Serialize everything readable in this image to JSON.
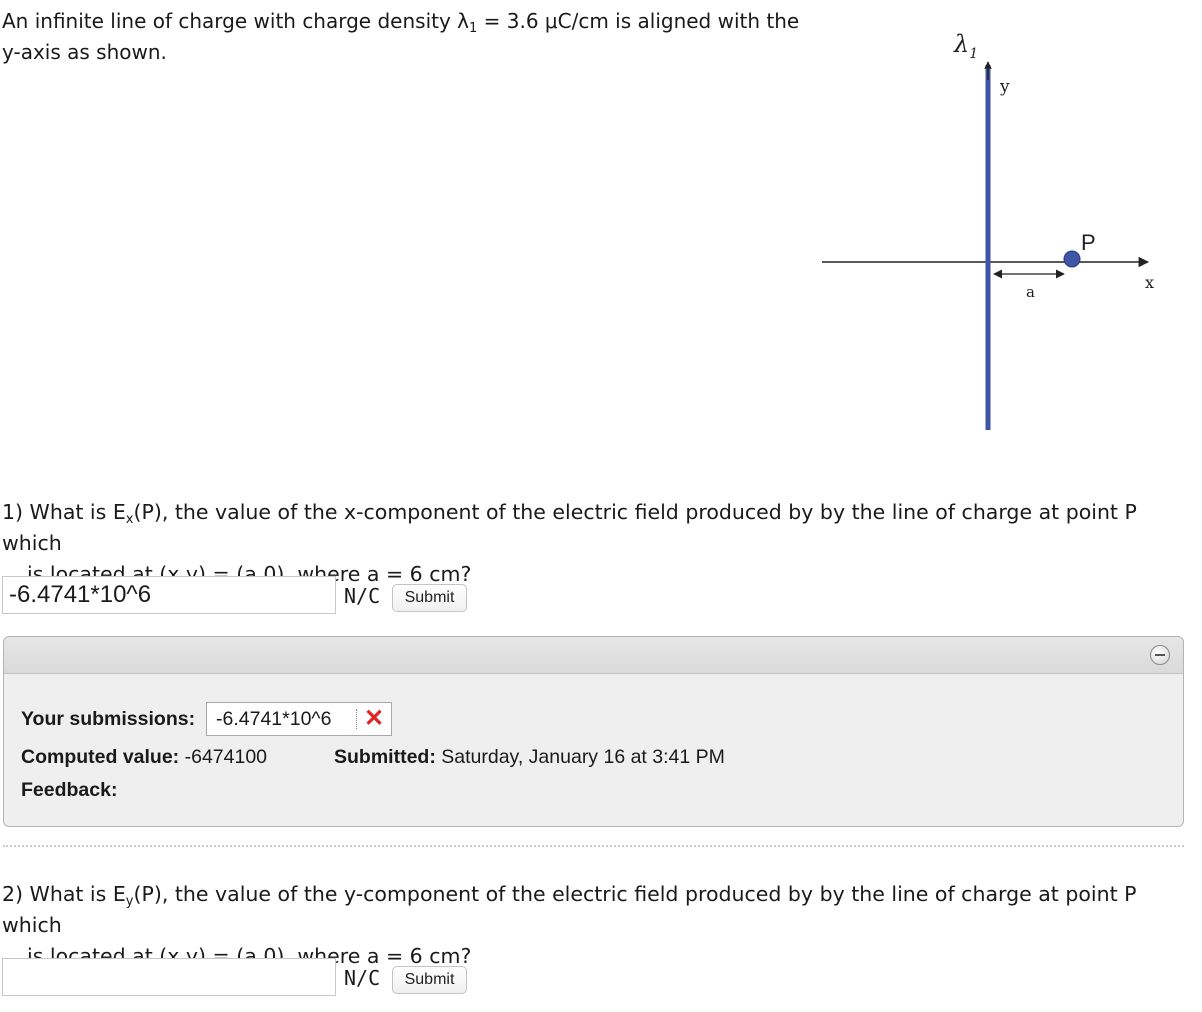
{
  "intro": {
    "text_before": "An infinite line of charge with charge density λ",
    "lambda_sub": "1",
    "text_after": " = 3.6 μC/cm is aligned with the",
    "line2": "y-axis as shown."
  },
  "figure": {
    "lambda_label": "λ",
    "lambda_sub": "1",
    "y_label": "y",
    "x_label": "x",
    "p_label": "P",
    "a_label": "a",
    "colors": {
      "line_of_charge": "#3e55a6",
      "point": "#3e55a6",
      "axes": "#222222"
    }
  },
  "q1": {
    "num": "1) What is E",
    "sub": "x",
    "rest": "(P), the value of the x-component of the electric field produced by by the line of charge at point P which",
    "line2": "is located at (x,y) = (a,0), where a = 6 cm?",
    "answer_value": "-6.4741*10^6",
    "unit": "N/C",
    "submit_label": "Submit"
  },
  "submission_panel": {
    "your_submissions_label": "Your submissions:",
    "submission_value": "-6.4741*10^6",
    "incorrect_mark": "✕",
    "computed_label": "Computed value:",
    "computed_value": "-6474100",
    "submitted_label": "Submitted:",
    "submitted_value": "Saturday, January 16 at 3:41 PM",
    "feedback_label": "Feedback:"
  },
  "q2": {
    "num": "2) What is E",
    "sub": "y",
    "rest": "(P), the value of the y-component of the electric field produced by by the line of charge at point P which",
    "line2": "is located at (x,y) = (a,0), where a = 6 cm?",
    "answer_value": "",
    "unit": "N/C",
    "submit_label": "Submit"
  }
}
